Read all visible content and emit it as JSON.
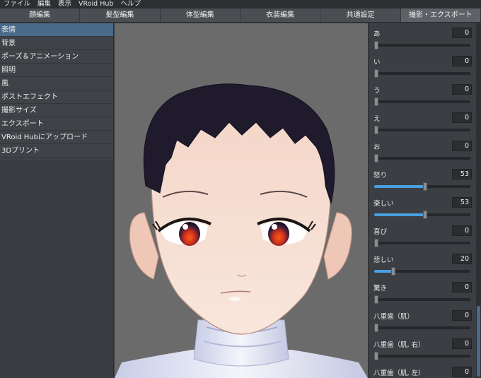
{
  "menubar": [
    "ファイル",
    "編集",
    "表示",
    "VRoid Hub",
    "ヘルプ"
  ],
  "tabs": [
    {
      "label": "顔編集",
      "active": false
    },
    {
      "label": "髪型編集",
      "active": false
    },
    {
      "label": "体型編集",
      "active": false
    },
    {
      "label": "衣装編集",
      "active": false
    },
    {
      "label": "共通設定",
      "active": false
    },
    {
      "label": "撮影・エクスポート",
      "active": true
    }
  ],
  "left_items": [
    {
      "label": "表情",
      "active": true
    },
    {
      "label": "背景",
      "active": false
    },
    {
      "label": "ポーズ＆アニメーション",
      "active": false
    },
    {
      "label": "照明",
      "active": false
    },
    {
      "label": "風",
      "active": false
    },
    {
      "label": "ポストエフェクト",
      "active": false
    },
    {
      "label": "撮影サイズ",
      "active": false
    },
    {
      "label": "エクスポート",
      "active": false
    },
    {
      "label": "VRoid Hubにアップロード",
      "active": false
    },
    {
      "label": "3Dプリント",
      "active": false
    }
  ],
  "params": [
    {
      "label": "あ",
      "value": "0",
      "level": 0
    },
    {
      "label": "い",
      "value": "0",
      "level": 0
    },
    {
      "label": "う",
      "value": "0",
      "level": 0
    },
    {
      "label": "え",
      "value": "0",
      "level": 0
    },
    {
      "label": "お",
      "value": "0",
      "level": 0
    },
    {
      "label": "怒り",
      "value": "53",
      "level": 53
    },
    {
      "label": "楽しい",
      "value": "53",
      "level": 53
    },
    {
      "label": "喜び",
      "value": "0",
      "level": 0
    },
    {
      "label": "悲しい",
      "value": "20",
      "level": 20
    },
    {
      "label": "驚き",
      "value": "0",
      "level": 0
    },
    {
      "label": "八重歯（肌）",
      "value": "0",
      "level": 0
    },
    {
      "label": "八重歯（肌, 右）",
      "value": "0",
      "level": 0
    },
    {
      "label": "八重歯（肌, 左）",
      "value": "0",
      "level": 0
    }
  ],
  "colors": {
    "accent": "#4a9fe0",
    "active_item": "#4a6a8a",
    "viewport_bg": "#6b6b6b"
  }
}
